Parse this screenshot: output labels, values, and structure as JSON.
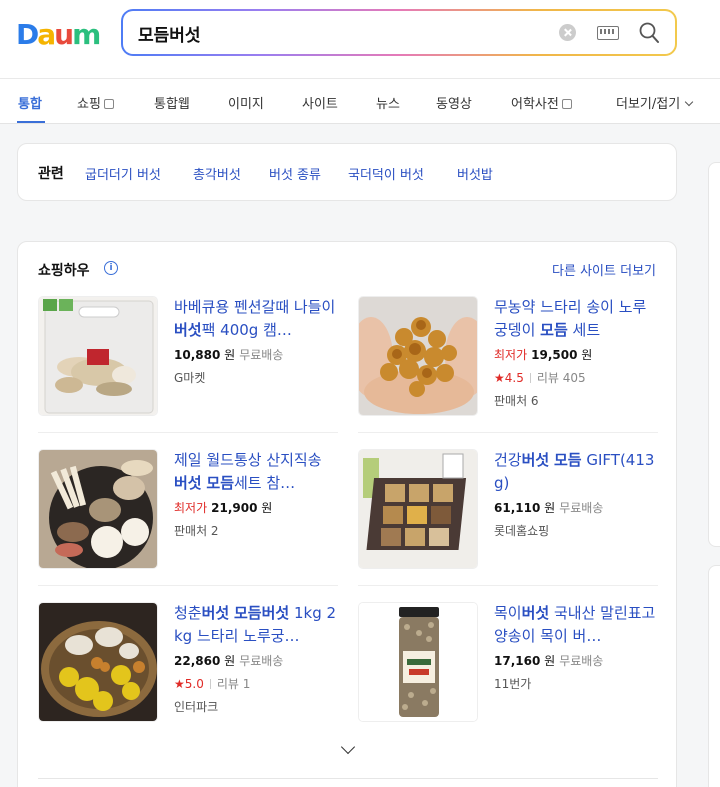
{
  "header": {
    "logo": {
      "text": "Daum",
      "letters": [
        "D",
        "a",
        "u",
        "m"
      ],
      "colors": [
        "#2b7ce9",
        "#f5b400",
        "#e84a3c",
        "#2bbf7e"
      ]
    },
    "search": {
      "value": "모듬버섯"
    }
  },
  "tabs": [
    {
      "label": "통합",
      "active": true
    },
    {
      "label": "쇼핑",
      "external": true
    },
    {
      "label": "통합웹"
    },
    {
      "label": "이미지"
    },
    {
      "label": "사이트"
    },
    {
      "label": "뉴스"
    },
    {
      "label": "동영상"
    },
    {
      "label": "어학사전",
      "external": true
    },
    {
      "label": "더보기/접기"
    }
  ],
  "related": {
    "label": "관련",
    "links": [
      "굽더더기 버섯",
      "총각버섯",
      "버섯 종류",
      "국더덕이 버섯",
      "버섯밥"
    ]
  },
  "shopping": {
    "title": "쇼핑하우",
    "info_icon": "i",
    "more": "다른 사이트 더보기",
    "items": [
      {
        "title": "바베큐용 펜션갈때 나들이버섯팩 400g 캠…",
        "price": "10,880",
        "won": "원",
        "shipping": "무료배송",
        "seller": "G마켓",
        "thumb": "mushroom-pack-image"
      },
      {
        "title": "무농약 느타리 송이 노루궁뎅이 모듬 세트",
        "lowest": "최저가",
        "price": "19,500",
        "won": "원",
        "rating": "4.5",
        "review": "리뷰 405",
        "sellers": "판매처 6",
        "thumb": "hands-mushrooms-image"
      },
      {
        "title": "제일 월드통상 산지직송 버섯 모듬세트 참…",
        "lowest": "최저가",
        "price": "21,900",
        "won": "원",
        "sellers": "판매처 2",
        "thumb": "mushroom-platter-image"
      },
      {
        "title": "건강버섯 모듬 GIFT(413g)",
        "price": "61,110",
        "won": "원",
        "shipping": "무료배송",
        "seller": "롯데홈쇼핑",
        "thumb": "gift-box-image"
      },
      {
        "title": "청춘버섯 모듬버섯 1kg 2kg 느타리 노루궁…",
        "price": "22,860",
        "won": "원",
        "shipping": "무료배송",
        "rating": "5.0",
        "review": "리뷰 1",
        "seller": "인터파크",
        "thumb": "mushroom-basket-image"
      },
      {
        "title": "목이버섯 국내산 말린표고 양송이 목이 버…",
        "price": "17,160",
        "won": "원",
        "shipping": "무료배송",
        "seller": "11번가",
        "thumb": "dried-mushroom-jar-image"
      }
    ]
  }
}
